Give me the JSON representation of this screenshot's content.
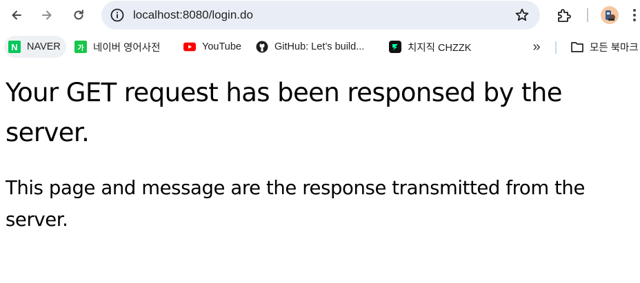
{
  "toolbar": {
    "back_icon": "arrow-left-icon",
    "forward_icon": "arrow-right-icon",
    "reload_icon": "reload-icon",
    "url": "localhost:8080/login.do",
    "site_info_icon": "info-icon",
    "bookmark_star_icon": "star-icon",
    "extensions_icon": "puzzle-icon",
    "profile_icon": "avatar",
    "menu_icon": "more-vert-icon"
  },
  "bookmarks": {
    "items": [
      {
        "label": "NAVER",
        "icon": "naver-icon",
        "icon_text": "N"
      },
      {
        "label": "네이버 영어사전",
        "icon": "dictionary-icon",
        "icon_text": "가"
      },
      {
        "label": "YouTube",
        "icon": "youtube-icon"
      },
      {
        "label": "GitHub: Let’s build...",
        "icon": "github-icon"
      },
      {
        "label": "치지직 CHZZK",
        "icon": "chzzk-icon"
      }
    ],
    "overflow_label": "»",
    "all_bookmarks_label": "모든 북마크"
  },
  "content": {
    "heading": "Your GET request has been responsed by the server.",
    "subheading": "This page and message are the response transmitted from the server."
  },
  "colors": {
    "omnibox_bg": "#e9eef6",
    "naver_green": "#03c75a",
    "youtube_red": "#ff0000",
    "chzzk_green": "#00ffa3"
  }
}
